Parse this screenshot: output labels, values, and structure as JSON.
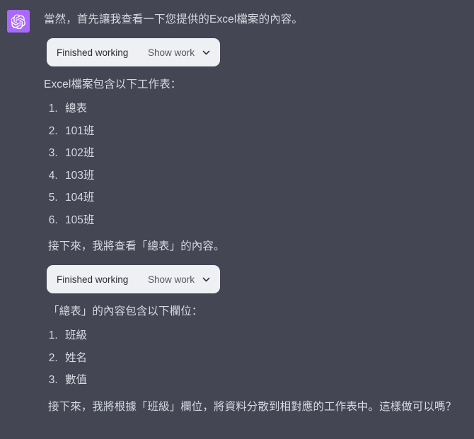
{
  "theme": {
    "background": "#444654",
    "text_color": "#d7dae0",
    "avatar_background": "#ab68ff",
    "card_background": "#eff0f3",
    "card_text": "#2c2c33",
    "card_action_text": "#55555f"
  },
  "message": {
    "avatar_icon": "openai-logo-icon",
    "intro_paragraph": "當然，首先讓我查看一下您提供的Excel檔案的內容。",
    "tool_card_1": {
      "status": "Finished working",
      "action": "Show work",
      "chevron_icon": "chevron-down-icon"
    },
    "sheets_heading": "Excel檔案包含以下工作表：",
    "sheets": [
      "總表",
      "101班",
      "102班",
      "103班",
      "104班",
      "105班"
    ],
    "next_step_paragraph": "接下來，我將查看「總表」的內容。",
    "tool_card_2": {
      "status": "Finished working",
      "action": "Show work",
      "chevron_icon": "chevron-down-icon"
    },
    "fields_heading": "「總表」的內容包含以下欄位：",
    "fields": [
      "班級",
      "姓名",
      "數值"
    ],
    "closing_paragraph": "接下來，我將根據「班級」欄位，將資料分散到相對應的工作表中。這樣做可以嗎？"
  }
}
